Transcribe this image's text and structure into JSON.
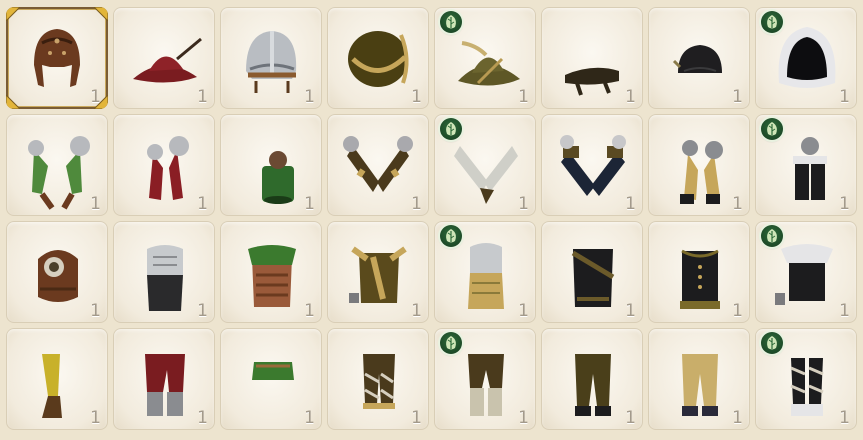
{
  "inventory": {
    "slots": [
      {
        "icon": "aviator-cap-icon",
        "qty": "1",
        "selected": true,
        "badge": false
      },
      {
        "icon": "red-feather-hat-icon",
        "qty": "1",
        "selected": false,
        "badge": false
      },
      {
        "icon": "steel-helmet-icon",
        "qty": "1",
        "selected": false,
        "badge": false
      },
      {
        "icon": "fur-cap-icon",
        "qty": "1",
        "selected": false,
        "badge": false
      },
      {
        "icon": "olive-feather-hat-icon",
        "qty": "1",
        "selected": false,
        "badge": true
      },
      {
        "icon": "dark-bandana-icon",
        "qty": "1",
        "selected": false,
        "badge": false
      },
      {
        "icon": "black-skullcap-icon",
        "qty": "1",
        "selected": false,
        "badge": false
      },
      {
        "icon": "fur-hood-icon",
        "qty": "1",
        "selected": false,
        "badge": true
      },
      {
        "icon": "green-gauntlets-icon",
        "qty": "1",
        "selected": false,
        "badge": false
      },
      {
        "icon": "red-gauntlets-icon",
        "qty": "1",
        "selected": false,
        "badge": false
      },
      {
        "icon": "green-bracer-icon",
        "qty": "1",
        "selected": false,
        "badge": false
      },
      {
        "icon": "fur-wrapped-gloves-icon",
        "qty": "1",
        "selected": false,
        "badge": false
      },
      {
        "icon": "silver-gauntlets-icon",
        "qty": "1",
        "selected": false,
        "badge": true
      },
      {
        "icon": "blue-wrapped-gloves-icon",
        "qty": "1",
        "selected": false,
        "badge": false
      },
      {
        "icon": "tan-gauntlets-icon",
        "qty": "1",
        "selected": false,
        "badge": false
      },
      {
        "icon": "fur-trim-bracers-icon",
        "qty": "1",
        "selected": false,
        "badge": true
      },
      {
        "icon": "leather-cuirass-icon",
        "qty": "1",
        "selected": false,
        "badge": false
      },
      {
        "icon": "steel-plate-armor-icon",
        "qty": "1",
        "selected": false,
        "badge": false
      },
      {
        "icon": "green-cape-armor-icon",
        "qty": "1",
        "selected": false,
        "badge": false
      },
      {
        "icon": "straw-vest-icon",
        "qty": "1",
        "selected": false,
        "badge": false
      },
      {
        "icon": "steel-straw-armor-icon",
        "qty": "1",
        "selected": false,
        "badge": true
      },
      {
        "icon": "dark-jerkin-icon",
        "qty": "1",
        "selected": false,
        "badge": false
      },
      {
        "icon": "black-vest-icon",
        "qty": "1",
        "selected": false,
        "badge": false
      },
      {
        "icon": "fur-collar-vest-icon",
        "qty": "1",
        "selected": false,
        "badge": true
      },
      {
        "icon": "yellow-leggings-icon",
        "qty": "1",
        "selected": false,
        "badge": false
      },
      {
        "icon": "red-pants-icon",
        "qty": "1",
        "selected": false,
        "badge": false
      },
      {
        "icon": "green-kilt-icon",
        "qty": "1",
        "selected": false,
        "badge": false
      },
      {
        "icon": "wrapped-trousers-icon",
        "qty": "1",
        "selected": false,
        "badge": false
      },
      {
        "icon": "olive-breeches-icon",
        "qty": "1",
        "selected": false,
        "badge": true
      },
      {
        "icon": "olive-trousers-icon",
        "qty": "1",
        "selected": false,
        "badge": false
      },
      {
        "icon": "tan-trousers-icon",
        "qty": "1",
        "selected": false,
        "badge": false
      },
      {
        "icon": "fur-wrapped-legs-icon",
        "qty": "1",
        "selected": false,
        "badge": true
      }
    ]
  }
}
